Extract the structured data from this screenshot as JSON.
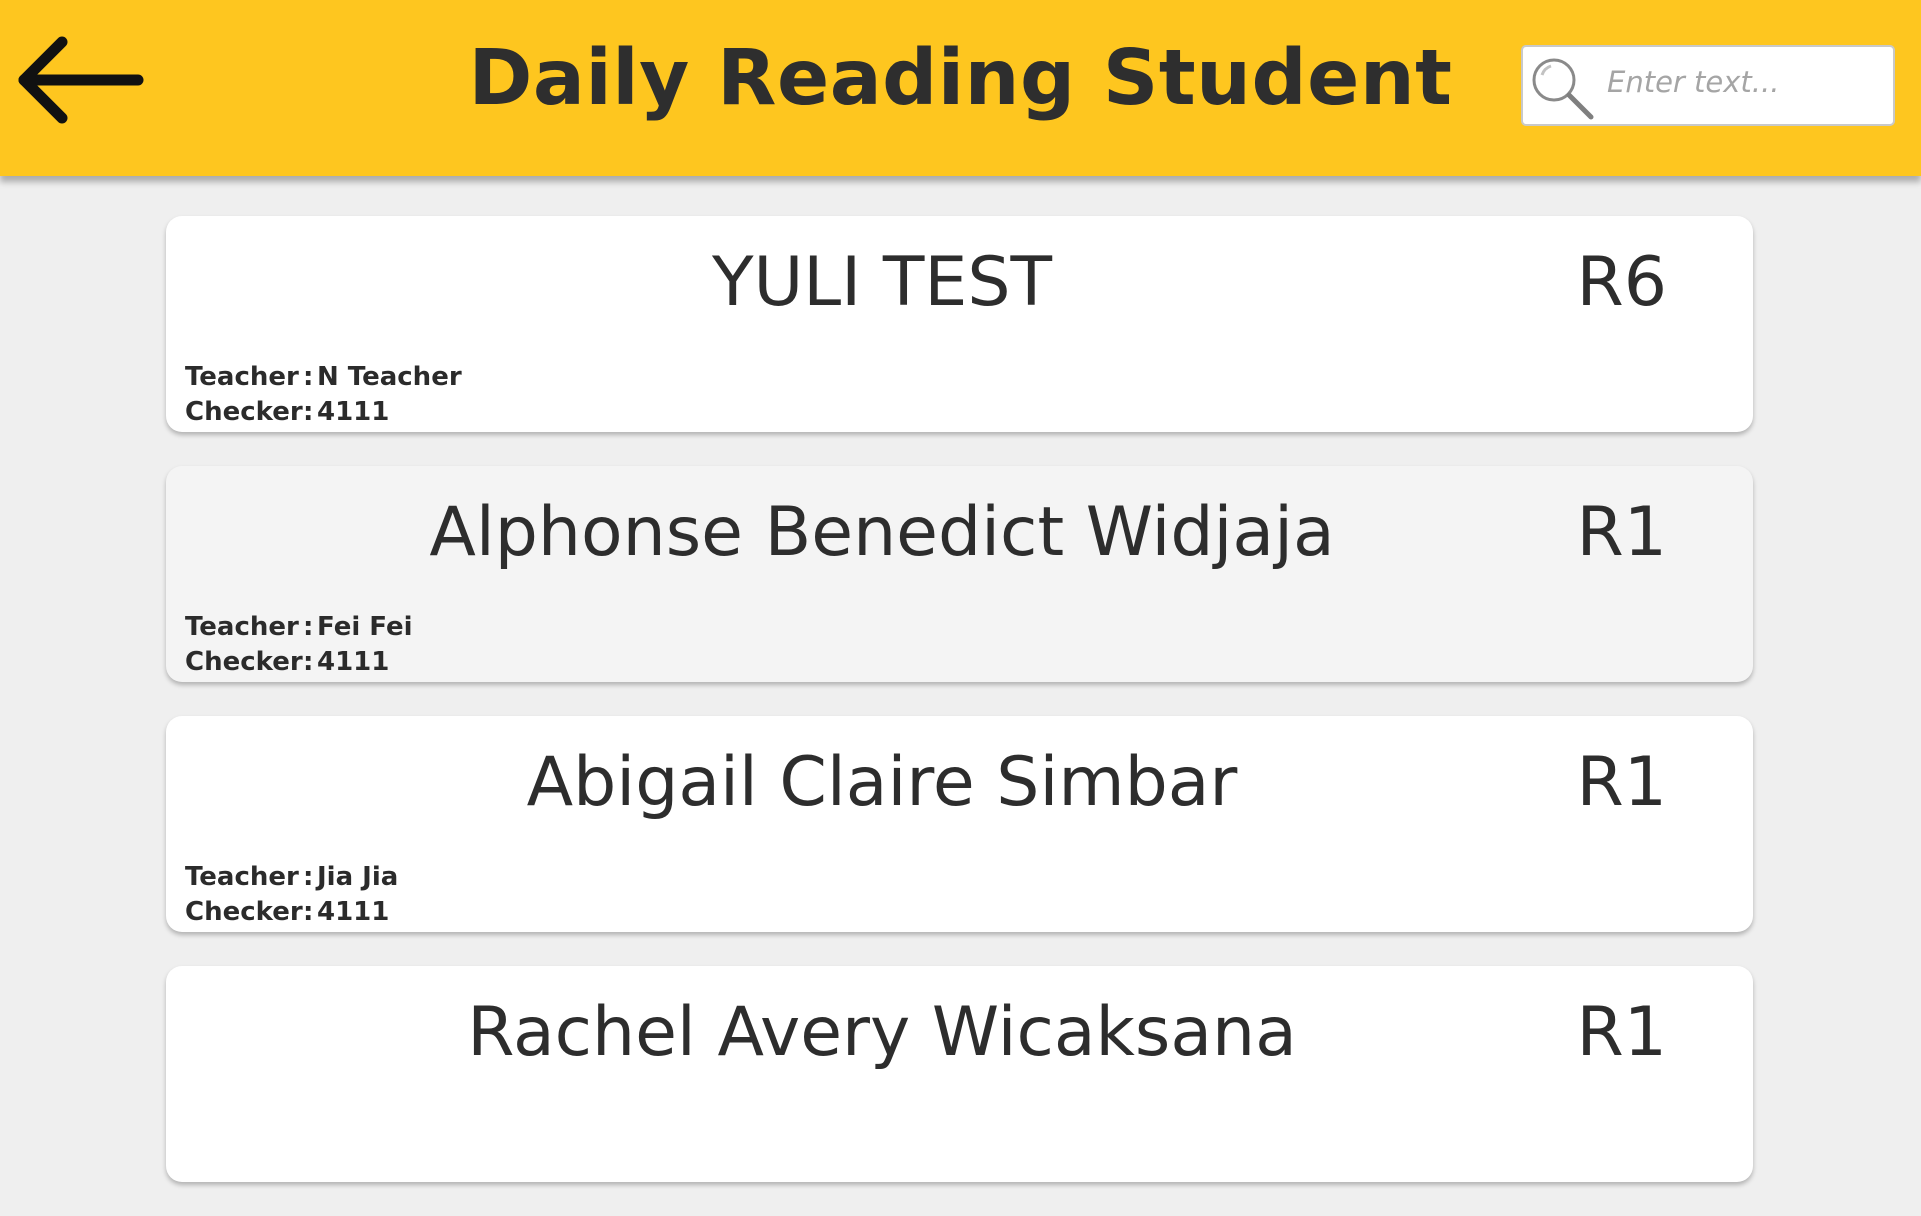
{
  "header": {
    "title": "Daily Reading Student",
    "back_icon": "arrow-left-icon",
    "search": {
      "icon": "magnifier-icon",
      "placeholder": "Enter text...",
      "value": ""
    },
    "colors": {
      "header_bg": "#fec61f",
      "page_bg": "#efefef"
    }
  },
  "labels": {
    "teacher": "Teacher",
    "checker": "Checker",
    "separator": ":"
  },
  "students": [
    {
      "name": "YULI TEST",
      "level": "R6",
      "teacher": "N Teacher",
      "checker": "4111"
    },
    {
      "name": "Alphonse Benedict Widjaja",
      "level": "R1",
      "teacher": "Fei Fei",
      "checker": "4111"
    },
    {
      "name": "Abigail Claire Simbar",
      "level": "R1",
      "teacher": "Jia Jia",
      "checker": "4111"
    },
    {
      "name": "Rachel Avery Wicaksana",
      "level": "R1",
      "teacher": "",
      "checker": ""
    }
  ]
}
